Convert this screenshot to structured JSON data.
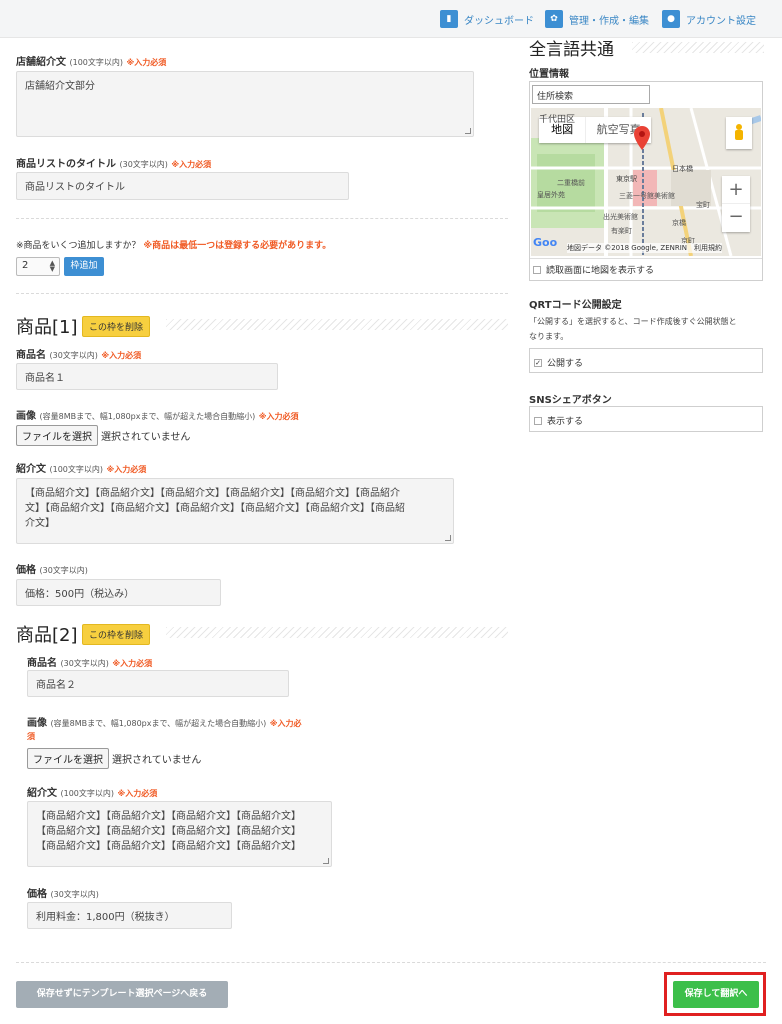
{
  "nav": {
    "dashboard": "ダッシュボード",
    "manage": "管理・作成・編集",
    "account": "アカウント設定"
  },
  "store_intro": {
    "label": "店舗紹介文",
    "limit": "(100文字以内)",
    "required": "※入力必須",
    "value": "店舗紹介文部分"
  },
  "product_list_title": {
    "label": "商品リストのタイトル",
    "limit": "(30文字以内)",
    "required": "※入力必須",
    "value": "商品リストのタイトル"
  },
  "add_products": {
    "question": "※商品をいくつ追加しますか？",
    "warning": "※商品は最低一つは登録する必要があります。",
    "count": "2",
    "button": "枠追加"
  },
  "products": [
    {
      "heading": "商品[1]",
      "delete_button": "この枠を削除",
      "name_label": "商品名",
      "name_limit": "(30文字以内)",
      "name_required": "※入力必須",
      "name_value": "商品名１",
      "image_label": "画像",
      "image_note": "(容量8MBまで、幅1,080pxまで、幅が超えた場合自動縮小)",
      "image_required": "※入力必須",
      "file_button": "ファイルを選択",
      "file_status": "選択されていません",
      "intro_label": "紹介文",
      "intro_limit": "(100文字以内)",
      "intro_required": "※入力必須",
      "intro_lines": [
        "【商品紹介文】【商品紹介文】【商品紹介文】【商品紹介文】【商品紹介文】【商品紹介",
        "文】【商品紹介文】【商品紹介文】【商品紹介文】【商品紹介文】【商品紹介文】【商品紹",
        "介文】"
      ],
      "price_label": "価格",
      "price_limit": "(30文字以内)",
      "price_value": "価格：500円（税込み）"
    },
    {
      "heading": "商品[2]",
      "delete_button": "この枠を削除",
      "name_label": "商品名",
      "name_limit": "(30文字以内)",
      "name_required": "※入力必須",
      "name_value": "商品名２",
      "image_label": "画像",
      "image_note": "(容量8MBまで、幅1,080pxまで、幅が超えた場合自動縮小)",
      "image_required_a": "※入力必",
      "image_required_b": "須",
      "file_button": "ファイルを選択",
      "file_status": "選択されていません",
      "intro_label": "紹介文",
      "intro_limit": "(100文字以内)",
      "intro_required": "※入力必須",
      "intro_lines": [
        "【商品紹介文】【商品紹介文】【商品紹介文】【商品紹介文】",
        "【商品紹介文】【商品紹介文】【商品紹介文】【商品紹介文】",
        "【商品紹介文】【商品紹介文】【商品紹介文】【商品紹介文】"
      ],
      "price_label": "価格",
      "price_limit": "(30文字以内)",
      "price_value": "利用料金：1,800円（税抜き）"
    }
  ],
  "sidebar": {
    "heading": "全言語共通",
    "location_label": "位置情報",
    "address_search": "住所検索",
    "map_tab_map": "地図",
    "map_tab_aerial": "航空写真",
    "map_attribution": "地図データ ©2018 Google, ZENRIN　利用規約",
    "map_labels": [
      "千代田区",
      "二重橋前",
      "皇居外苑",
      "東京駅",
      "日本橋",
      "三菱一号館美術館",
      "出光美術館",
      "有楽町",
      "京橋",
      "宝町",
      "京町"
    ],
    "show_map_label": "読取画面に地図を表示する",
    "qrt_label": "QRTコード公開設定",
    "qrt_desc_1": "「公開する」を選択すると、コード作成後すぐ公開状態と",
    "qrt_desc_2": "なります。",
    "qrt_checkbox": "公開する",
    "sns_label": "SNSシェアボタン",
    "sns_checkbox": "表示する"
  },
  "footer": {
    "back_button": "保存せずにテンプレート選択ページへ戻る",
    "save_button": "保存して翻訳へ"
  },
  "colors": {
    "accent_blue": "#3d8fd3",
    "required_orange": "#f05a24",
    "delete_yellow": "#f7cf3f",
    "save_green": "#3cbf4a",
    "highlight_red": "#e02020"
  }
}
